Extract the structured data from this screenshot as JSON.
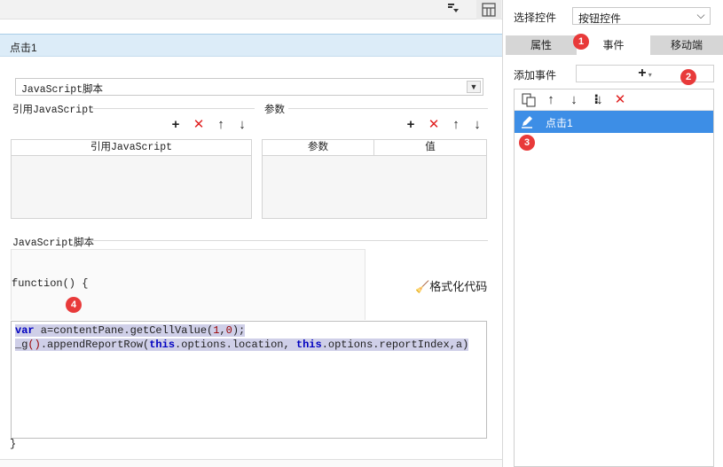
{
  "left": {
    "event_title": "点击1",
    "type_select": "JavaScript脚本",
    "ref_section_label": "引用JavaScript",
    "ref_table_header": "引用JavaScript",
    "param_section_label": "参数",
    "param_header_name": "参数",
    "param_header_value": "值",
    "script_section_label": "JavaScript脚本",
    "function_open": "function() {",
    "function_close": "}",
    "format_code_label": "格式化代码",
    "code_line1": {
      "kw": "var",
      "text": " a=contentPane.getCellValue(",
      "n1": "1",
      "comma": ",",
      "n2": "0",
      "tail": ");"
    },
    "code_line2": {
      "pre": "_g",
      "paren": "()",
      "mid": ".appendReportRow(",
      "kw1": "this",
      "mid2": ".options.location, ",
      "kw2": "this",
      "tail": ".options.reportIndex,a)"
    }
  },
  "right": {
    "select_control_label": "选择控件",
    "select_control_value": "按钮控件",
    "tabs": [
      "属性",
      "事件",
      "移动端"
    ],
    "active_tab": "事件",
    "add_event_label": "添加事件",
    "add_event_button": "+",
    "events": [
      "点击1"
    ]
  },
  "badges": [
    "1",
    "2",
    "3",
    "4"
  ],
  "colors": {
    "selection": "#3d8ee6",
    "title_bg": "#dcecf8",
    "badge": "#e83a3a",
    "delete": "#e02020"
  }
}
